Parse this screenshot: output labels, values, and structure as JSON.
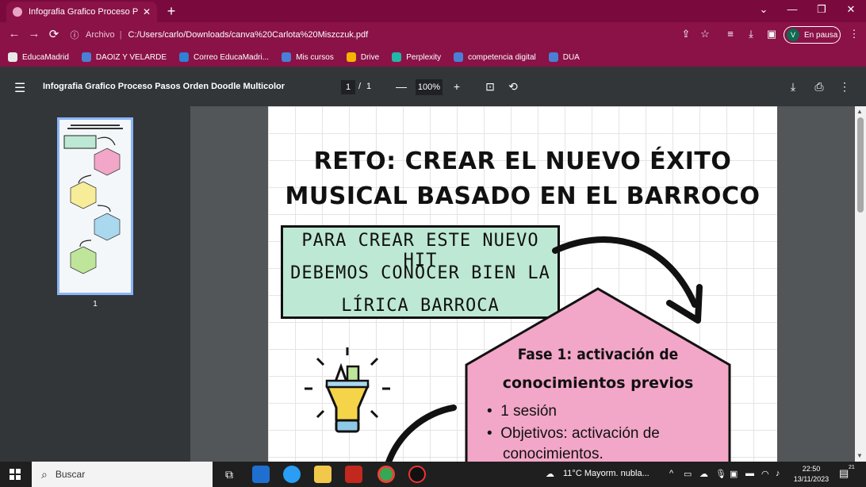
{
  "browser": {
    "tab_title": "Infografia Grafico Proceso Pasos",
    "tab_close": "✕",
    "new_tab": "+",
    "window_controls": {
      "list": "⌄",
      "minimize": "—",
      "restore": "❐",
      "close": "✕"
    },
    "nav": {
      "back": "←",
      "forward": "→",
      "reload": "⟳"
    },
    "address": {
      "scheme": "Archivo",
      "separator": "|",
      "url": "C:/Users/carlo/Downloads/canva%20Carlota%20Miszczuk.pdf"
    },
    "profile": {
      "initial": "V",
      "status": "En pausa"
    },
    "bookmarks": [
      {
        "label": "EducaMadrid",
        "icon": "#e8e8e8"
      },
      {
        "label": "DAOIZ Y VELARDE",
        "icon": "#4a7fd6"
      },
      {
        "label": "Correo EducaMadri...",
        "icon": "#2f80d6"
      },
      {
        "label": "Mis cursos",
        "icon": "#4a7fd6"
      },
      {
        "label": "Drive",
        "icon": "#f4b400"
      },
      {
        "label": "Perplexity",
        "icon": "#20b8a8"
      },
      {
        "label": "competencia digital",
        "icon": "#4a7fd6"
      },
      {
        "label": "DUA",
        "icon": "#4a7fd6"
      }
    ]
  },
  "viewer": {
    "menu": "☰",
    "doc_title": "Infografia Grafico Proceso Pasos Orden Doodle Multicolor",
    "page_current": "1",
    "page_sep": "/",
    "page_total": "1",
    "zoom_out": "—",
    "zoom": "100%",
    "zoom_in": "+",
    "thumb_label": "1"
  },
  "document": {
    "title_line1": "RETO: CREAR EL NUEVO ÉXITO",
    "title_line2": "MUSICAL BASADO EN EL BARROCO",
    "intro_lines": [
      "PARA CREAR ESTE NUEVO HIT",
      "DEBEMOS CONOCER BIEN LA",
      "LÍRICA BARROCA"
    ],
    "phase1_title_1": "Fase 1: activación de",
    "phase1_title_2": "conocimientos previos",
    "phase1_bullets": [
      "1 sesión",
      "Objetivos: activación de",
      "conocimientos."
    ]
  },
  "taskbar": {
    "search_placeholder": "Buscar",
    "weather": "11°C  Mayorm. nubla...",
    "time": "22:50",
    "date": "13/11/2023",
    "notification_count": "21"
  }
}
